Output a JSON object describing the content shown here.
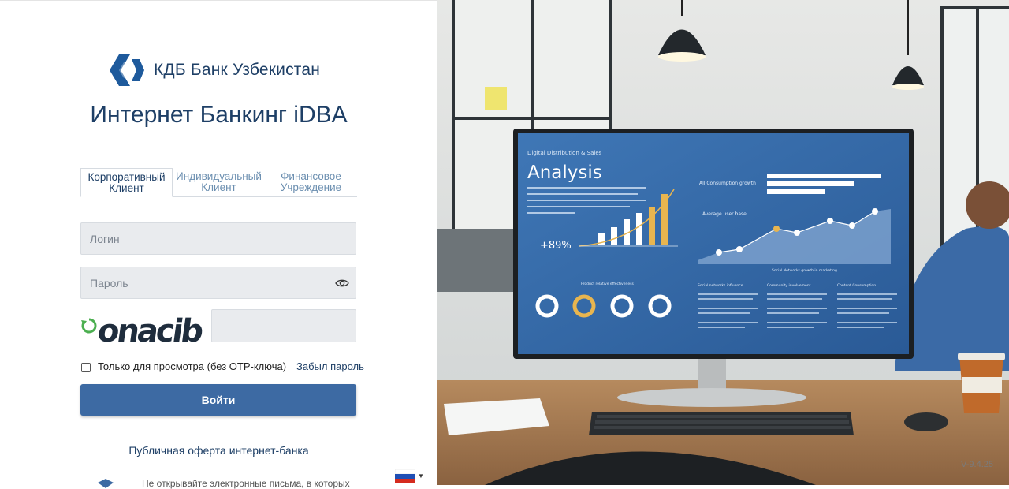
{
  "brand": {
    "name": "КДБ Банк Узбекистан",
    "logo_icon": "kdb-logo-icon",
    "color": "#1e3f66"
  },
  "page_title": "Интернет Банкинг iDBA",
  "tabs": [
    {
      "line1": "Корпоративный",
      "line2": "Клиент",
      "active": true
    },
    {
      "line1": "Индивидуальный",
      "line2": "Клиент",
      "active": false
    },
    {
      "line1": "Финансовое",
      "line2": "Учреждение",
      "active": false
    }
  ],
  "login": {
    "placeholder": "Логин",
    "value": ""
  },
  "password": {
    "placeholder": "Пароль",
    "value": ""
  },
  "captcha": {
    "text": "onacib",
    "input_value": ""
  },
  "view_only": {
    "label": "Только для просмотра (без OTP-ключа)",
    "checked": false
  },
  "forgot_link": "Забыл пароль",
  "submit_label": "Войти",
  "oferta_link": "Публичная оферта интернет-банка",
  "warning_text": "Не открывайте электронные письма, в которых",
  "language": {
    "flag": "ru-flag-icon"
  },
  "hero": {
    "panel_header": "Digital Distribution & Sales",
    "panel_title": "Analysis",
    "growth_value": "+89%",
    "all_consumption": "All Consumption growth",
    "average_user_base": "Average user base",
    "social_growth": "Social Networks growth in marketing",
    "product_effectiveness": "Product relative effectiveness",
    "col1": "Social networks influence",
    "col2": "Community involvement",
    "col3": "Content Consumption"
  },
  "version": "V-9.4.25",
  "colors": {
    "accent": "#3d6aa3",
    "field_bg": "#e9ebee"
  }
}
